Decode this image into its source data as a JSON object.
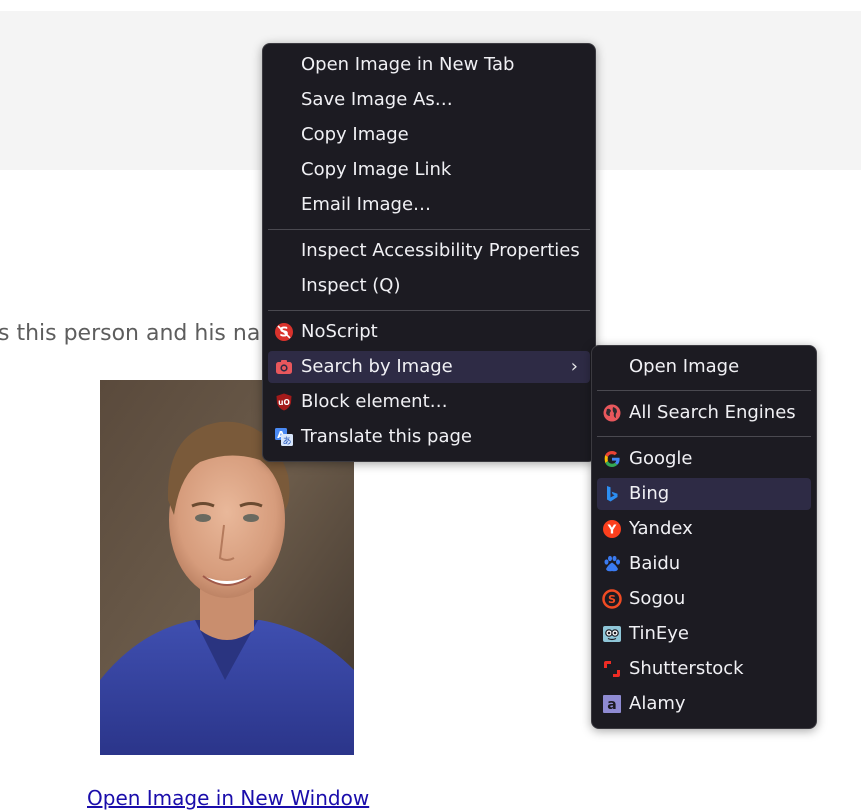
{
  "page": {
    "question_text": "s this person and his na",
    "open_link_label": "Open Image in New Window"
  },
  "context_menu": {
    "items": [
      {
        "label": "Open Image in New Tab"
      },
      {
        "label": "Save Image As…"
      },
      {
        "label": "Copy Image"
      },
      {
        "label": "Copy Image Link"
      },
      {
        "label": "Email Image…"
      },
      {
        "label": "Inspect Accessibility Properties"
      },
      {
        "label": "Inspect (Q)"
      },
      {
        "label": "NoScript",
        "icon": "noscript-icon"
      },
      {
        "label": "Search by Image",
        "icon": "camera-icon",
        "has_submenu": true,
        "highlighted": true
      },
      {
        "label": "Block element…",
        "icon": "ublock-icon"
      },
      {
        "label": "Translate this page",
        "icon": "translate-icon"
      }
    ]
  },
  "submenu": {
    "items": [
      {
        "label": "Open Image"
      },
      {
        "label": "All Search Engines",
        "icon": "globe-icon"
      },
      {
        "label": "Google",
        "icon": "google-icon"
      },
      {
        "label": "Bing",
        "icon": "bing-icon",
        "highlighted": true
      },
      {
        "label": "Yandex",
        "icon": "yandex-icon"
      },
      {
        "label": "Baidu",
        "icon": "baidu-icon"
      },
      {
        "label": "Sogou",
        "icon": "sogou-icon"
      },
      {
        "label": "TinEye",
        "icon": "tineye-icon"
      },
      {
        "label": "Shutterstock",
        "icon": "shutterstock-icon"
      },
      {
        "label": "Alamy",
        "icon": "alamy-icon"
      }
    ]
  },
  "colors": {
    "menu_bg": "#1c1b22",
    "menu_text": "#f0f0f4",
    "highlight_bg": "#2e2b45",
    "link": "#1a0dab"
  }
}
